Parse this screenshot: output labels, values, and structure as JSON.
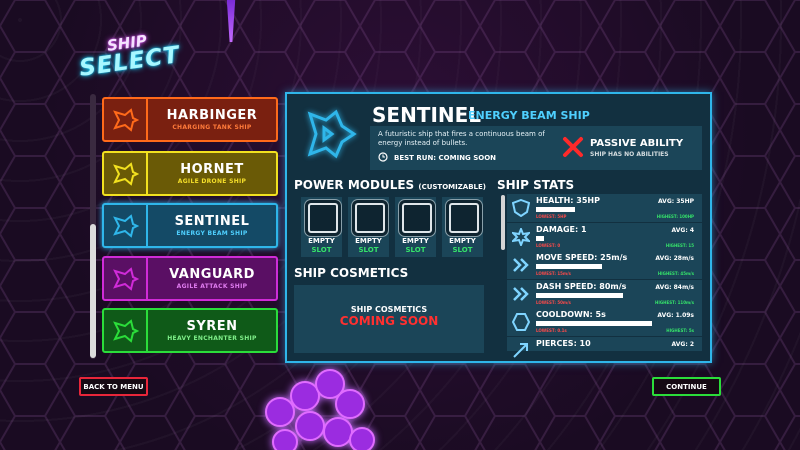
{
  "title": {
    "line1": "SHIP",
    "line2": "SELECT"
  },
  "ships": [
    {
      "name": "HARBINGER",
      "subtitle": "CHARGING TANK SHIP",
      "color": "#ff6a1a",
      "bg": "#7a2010",
      "sub_color": "#ff7a3a",
      "icon": "harbinger-ship-icon",
      "selected": false
    },
    {
      "name": "HORNET",
      "subtitle": "AGILE DRONE SHIP",
      "color": "#f2e11f",
      "bg": "#6a5a06",
      "sub_color": "#f5df2a",
      "icon": "hornet-ship-icon",
      "selected": false
    },
    {
      "name": "SENTINEL",
      "subtitle": "ENERGY BEAM SHIP",
      "color": "#2fb6ea",
      "bg": "#144a66",
      "sub_color": "#4fd0ff",
      "icon": "sentinel-ship-icon",
      "selected": true
    },
    {
      "name": "VANGUARD",
      "subtitle": "AGILE ATTACK SHIP",
      "color": "#d02bd8",
      "bg": "#5a0f64",
      "sub_color": "#e07cf0",
      "icon": "vanguard-ship-icon",
      "selected": false
    },
    {
      "name": "SYREN",
      "subtitle": "HEAVY ENCHANTER SHIP",
      "color": "#2bdd3a",
      "bg": "#0f5a18",
      "sub_color": "#7ff08a",
      "icon": "syren-ship-icon",
      "selected": false
    }
  ],
  "detail": {
    "name": "SENTINEL",
    "subtitle": "ENERGY BEAM SHIP",
    "description": "A futuristic ship that fires a continuous beam of energy instead of bullets.",
    "best_run": "BEST RUN: COMING SOON",
    "passive_title": "PASSIVE ABILITY",
    "passive_sub": "SHIP HAS NO ABILITIES"
  },
  "power_modules": {
    "title": "POWER MODULES",
    "note": "(CUSTOMIZABLE)",
    "slots": [
      {
        "line1": "EMPTY",
        "line2": "SLOT"
      },
      {
        "line1": "EMPTY",
        "line2": "SLOT"
      },
      {
        "line1": "EMPTY",
        "line2": "SLOT"
      },
      {
        "line1": "EMPTY",
        "line2": "SLOT"
      }
    ]
  },
  "cosmetics": {
    "title": "SHIP COSMETICS",
    "label": "SHIP COSMETICS",
    "status": "COMING SOON"
  },
  "stats": {
    "title": "SHIP STATS",
    "items": [
      {
        "label": "HEALTH: 35HP",
        "avg": "AVG: 35HP",
        "lowest": "LOWEST: 5HP",
        "highest": "HIGHEST: 100HP",
        "fill": 0.33,
        "icon": "shield-icon"
      },
      {
        "label": "DAMAGE: 1",
        "avg": "AVG: 4",
        "lowest": "LOWEST: 0",
        "highest": "HIGHEST: 15",
        "fill": 0.07,
        "icon": "burst-icon"
      },
      {
        "label": "MOVE SPEED: 25m/s",
        "avg": "AVG: 28m/s",
        "lowest": "LOWEST: 15m/s",
        "highest": "HIGHEST: 45m/s",
        "fill": 0.56,
        "icon": "chevrons-icon"
      },
      {
        "label": "DASH SPEED: 80m/s",
        "avg": "AVG: 84m/s",
        "lowest": "LOWEST: 50m/s",
        "highest": "HIGHEST: 110m/s",
        "fill": 0.74,
        "icon": "chevrons-icon"
      },
      {
        "label": "COOLDOWN: 5s",
        "avg": "AVG: 1.09s",
        "lowest": "LOWEST: 0.1s",
        "highest": "HIGHEST: 5s",
        "fill": 0.98,
        "icon": "hexagon-icon"
      },
      {
        "label": "PIERCES: 10",
        "avg": "AVG: 2",
        "lowest": "",
        "highest": "",
        "fill": 0.0,
        "icon": "arrow-icon"
      }
    ]
  },
  "buttons": {
    "back": "BACK TO MENU",
    "continue": "CONTINUE"
  }
}
